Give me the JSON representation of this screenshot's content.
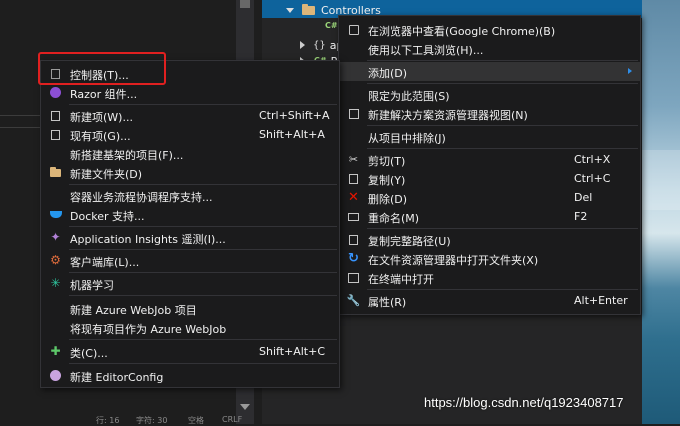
{
  "editor": {
    "status_left": "行: 16",
    "status_mid": "字符: 30",
    "status_ind": "空格",
    "status_eol": "CRLF"
  },
  "solution_explorer": {
    "rows": [
      {
        "label": "Controllers",
        "icon": "folder-icon",
        "expanded": true,
        "selected": true
      },
      {
        "label": "C#",
        "icon": "csharp-file-icon"
      },
      {
        "label": "ap",
        "icon": "json-file-icon"
      },
      {
        "label": "Pr",
        "icon": "csharp-file-icon"
      }
    ]
  },
  "left_menu": {
    "items": [
      {
        "label": "控制器(T)...",
        "shortcut": "",
        "icon": "controller-icon"
      },
      {
        "label": "Razor 组件...",
        "shortcut": "",
        "icon": "razor-component-icon"
      },
      {
        "label": "新建项(W)...",
        "shortcut": "Ctrl+Shift+A",
        "icon": "new-item-icon"
      },
      {
        "label": "现有项(G)...",
        "shortcut": "Shift+Alt+A",
        "icon": "existing-item-icon"
      },
      {
        "label": "新搭建基架的项目(F)...",
        "shortcut": "",
        "icon": ""
      },
      {
        "label": "新建文件夹(D)",
        "shortcut": "",
        "icon": "new-folder-icon"
      },
      {
        "label": "容器业务流程协调程序支持...",
        "shortcut": "",
        "icon": ""
      },
      {
        "label": "Docker 支持...",
        "shortcut": "",
        "icon": "docker-icon"
      },
      {
        "label": "Application Insights 遥测(I)...",
        "shortcut": "",
        "icon": "app-insights-icon"
      },
      {
        "label": "客户端库(L)...",
        "shortcut": "",
        "icon": "client-library-icon"
      },
      {
        "label": "机器学习",
        "shortcut": "",
        "icon": "machine-learning-icon"
      },
      {
        "label": "新建 Azure WebJob 项目",
        "shortcut": "",
        "icon": ""
      },
      {
        "label": "将现有项目作为 Azure WebJob",
        "shortcut": "",
        "icon": ""
      },
      {
        "label": "类(C)...",
        "shortcut": "Shift+Alt+C",
        "icon": "class-icon"
      },
      {
        "label": "新建 EditorConfig",
        "shortcut": "",
        "icon": "editorconfig-icon"
      }
    ]
  },
  "right_menu": {
    "items": [
      {
        "label": "在浏览器中查看(Google Chrome)(B)",
        "shortcut": "",
        "icon": "view-in-browser-icon"
      },
      {
        "label": "使用以下工具浏览(H)...",
        "shortcut": "",
        "icon": ""
      },
      {
        "label": "添加(D)",
        "shortcut": "",
        "icon": "",
        "submenu": true
      },
      {
        "label": "限定为此范围(S)",
        "shortcut": "",
        "icon": ""
      },
      {
        "label": "新建解决方案资源管理器视图(N)",
        "shortcut": "",
        "icon": "new-solution-view-icon"
      },
      {
        "label": "从项目中排除(J)",
        "shortcut": "",
        "icon": ""
      },
      {
        "label": "剪切(T)",
        "shortcut": "Ctrl+X",
        "icon": "scissors-icon"
      },
      {
        "label": "复制(Y)",
        "shortcut": "Ctrl+C",
        "icon": "copy-icon"
      },
      {
        "label": "删除(D)",
        "shortcut": "Del",
        "icon": "delete-icon"
      },
      {
        "label": "重命名(M)",
        "shortcut": "F2",
        "icon": "rename-icon"
      },
      {
        "label": "复制完整路径(U)",
        "shortcut": "",
        "icon": "copy-path-icon"
      },
      {
        "label": "在文件资源管理器中打开文件夹(X)",
        "shortcut": "",
        "icon": "open-folder-icon"
      },
      {
        "label": "在终端中打开",
        "shortcut": "",
        "icon": "terminal-icon"
      },
      {
        "label": "属性(R)",
        "shortcut": "Alt+Enter",
        "icon": "wrench-icon"
      }
    ]
  },
  "colors": {
    "menu_bg": "#1b1b1c",
    "selection_blue": "#0e639c",
    "highlight_red": "#e02020",
    "submenu_arrow": "#2f8ee8"
  },
  "watermark": "https://blog.csdn.net/q1923408717"
}
